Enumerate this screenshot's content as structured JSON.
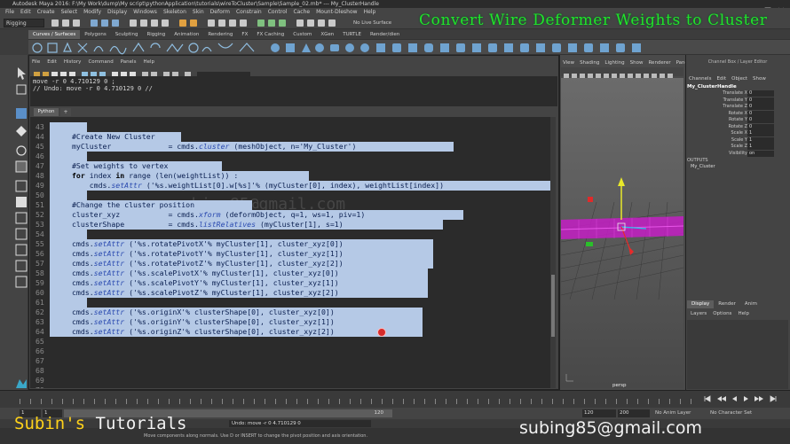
{
  "window": {
    "title": "Autodesk Maya 2016: F:\\My Work\\dump\\My script\\pythonApplication\\tutorials\\wireToCluster\\Sample\\Sample_02.mb*   ---   My_ClusterHandle"
  },
  "menus": [
    "File",
    "Edit",
    "Create",
    "Select",
    "Modify",
    "Display",
    "Windows",
    "Skeleton",
    "Skin",
    "Deform",
    "Constrain",
    "Control",
    "Cache",
    "Mount-Dleshow",
    "Help"
  ],
  "status_line": {
    "mode": "Rigging",
    "live_surface": "No Live Surface"
  },
  "shelf_tabs": [
    {
      "label": "Curves / Surfaces",
      "active": true
    },
    {
      "label": "Polygons",
      "active": false
    },
    {
      "label": "Sculpting",
      "active": false
    },
    {
      "label": "Rigging",
      "active": false
    },
    {
      "label": "Animation",
      "active": false
    },
    {
      "label": "Rendering",
      "active": false
    },
    {
      "label": "FX",
      "active": false
    },
    {
      "label": "FX Caching",
      "active": false
    },
    {
      "label": "Custom",
      "active": false
    },
    {
      "label": "XGen",
      "active": false
    },
    {
      "label": "TURTLE",
      "active": false
    },
    {
      "label": "Render/dien",
      "active": false
    }
  ],
  "script_editor": {
    "menus": [
      "File",
      "Edit",
      "History",
      "Command",
      "Panels",
      "Help"
    ],
    "history": [
      "move -r 0 4.710129 0 ;",
      "// Undo: move -r 0 4.710129 0  //"
    ],
    "tab_label": "Python",
    "add_tab": "+",
    "lines": [
      {
        "n": "43",
        "sel": 42,
        "t": ""
      },
      {
        "n": "44",
        "sel": 148,
        "t": "    #Create New Cluster"
      },
      {
        "n": "45",
        "sel": 455,
        "t": "    myCluster             = cmds.cluster (meshObject, n='My_Cluster')"
      },
      {
        "n": "46",
        "sel": 42,
        "t": ""
      },
      {
        "n": "47",
        "sel": 194,
        "t": "    #Set weights to vertex"
      },
      {
        "n": "48",
        "sel": 292,
        "t": "    for index in range (len(weightList)) :"
      },
      {
        "n": "49",
        "sel": 572,
        "t": "        cmds.setAttr ('%s.weightList[0].w[%s]'% (myCluster[0], index), weightList[index])"
      },
      {
        "n": "50",
        "sel": 42,
        "t": ""
      },
      {
        "n": "51",
        "sel": 228,
        "t": "    #Change the cluster position"
      },
      {
        "n": "52",
        "sel": 466,
        "t": "    cluster_xyz           = cmds.xform (deformObject, q=1, ws=1, piv=1)"
      },
      {
        "n": "53",
        "sel": 443,
        "t": "    clusterShape          = cmds.listRelatives (myCluster[1], s=1)"
      },
      {
        "n": "54",
        "sel": 42,
        "t": ""
      },
      {
        "n": "55",
        "sel": 432,
        "t": "    cmds.setAttr ('%s.rotatePivotX'% myCluster[1], cluster_xyz[0])"
      },
      {
        "n": "56",
        "sel": 432,
        "t": "    cmds.setAttr ('%s.rotatePivotY'% myCluster[1], cluster_xyz[1])"
      },
      {
        "n": "57",
        "sel": 432,
        "t": "    cmds.setAttr ('%s.rotatePivotZ'% myCluster[1], cluster_xyz[2])"
      },
      {
        "n": "58",
        "sel": 426,
        "t": "    cmds.setAttr ('%s.scalePivotX'% myCluster[1], cluster_xyz[0])"
      },
      {
        "n": "59",
        "sel": 426,
        "t": "    cmds.setAttr ('%s.scalePivotY'% myCluster[1], cluster_xyz[1])"
      },
      {
        "n": "60",
        "sel": 426,
        "t": "    cmds.setAttr ('%s.scalePivotZ'% myCluster[1], cluster_xyz[2])"
      },
      {
        "n": "61",
        "sel": 42,
        "t": ""
      },
      {
        "n": "62",
        "sel": 420,
        "t": "    cmds.setAttr ('%s.originX'% clusterShape[0], cluster_xyz[0])"
      },
      {
        "n": "63",
        "sel": 420,
        "t": "    cmds.setAttr ('%s.originY'% clusterShape[0], cluster_xyz[1])"
      },
      {
        "n": "64",
        "sel": 420,
        "t": "    cmds.setAttr ('%s.originZ'% clusterShape[0], cluster_xyz[2])"
      },
      {
        "n": "65",
        "sel": 0,
        "t": ""
      },
      {
        "n": "66",
        "sel": 0,
        "t": ""
      },
      {
        "n": "67",
        "sel": 0,
        "t": ""
      },
      {
        "n": "68",
        "sel": 0,
        "t": ""
      },
      {
        "n": "69",
        "sel": 0,
        "t": ""
      },
      {
        "n": "70",
        "sel": 0,
        "t": ""
      }
    ]
  },
  "viewport": {
    "menus": [
      "View",
      "Shading",
      "Lighting",
      "Show",
      "Renderer",
      "Panels"
    ],
    "camera_label": "persp"
  },
  "channel_box": {
    "title": "Channel Box / Layer Editor",
    "menus": [
      "Channels",
      "Edit",
      "Object",
      "Show"
    ],
    "node_name": "My_ClusterHandle",
    "attributes": [
      {
        "label": "Translate X",
        "value": "0"
      },
      {
        "label": "Translate Y",
        "value": "0"
      },
      {
        "label": "Translate Z",
        "value": "0"
      },
      {
        "label": "Rotate X",
        "value": "0"
      },
      {
        "label": "Rotate Y",
        "value": "0"
      },
      {
        "label": "Rotate Z",
        "value": "0"
      },
      {
        "label": "Scale X",
        "value": "1"
      },
      {
        "label": "Scale Y",
        "value": "1"
      },
      {
        "label": "Scale Z",
        "value": "1"
      },
      {
        "label": "Visibility",
        "value": "on"
      }
    ],
    "outputs_label": "OUTPUTS",
    "outputs_node": "My_Cluster"
  },
  "layer_editor": {
    "tabs": [
      {
        "label": "Display",
        "active": true
      },
      {
        "label": "Render",
        "active": false
      },
      {
        "label": "Anim",
        "active": false
      }
    ],
    "menus": [
      "Layers",
      "Options",
      "Help"
    ]
  },
  "timeline": {
    "start_field": "1",
    "current_field": "1",
    "range_start": "1",
    "range_slider_end": "120",
    "range_end": "120",
    "anim_end": "200",
    "anim_layer": "No Anim Layer",
    "character_set": "No Character Set"
  },
  "command_line": {
    "language": "Python",
    "field_value": "Undo: move -r 0 4.710129 0"
  },
  "help_line": "Move components along normals. Use D or INSERT to change the pivot position and axis orientation.",
  "overlays": {
    "title": "Convert Wire Deformer Weights to Cluster",
    "brand_first": "Subin's",
    "brand_second": " Tutorials",
    "email": "subing85@gmail.com",
    "watermark": "subing85@gmail.com"
  },
  "colors": {
    "overlay_title": "#23e22a",
    "selection": "#b5c9e6",
    "brand_yellow": "#ffd21a",
    "mesh_magenta": "#c41fc4"
  }
}
